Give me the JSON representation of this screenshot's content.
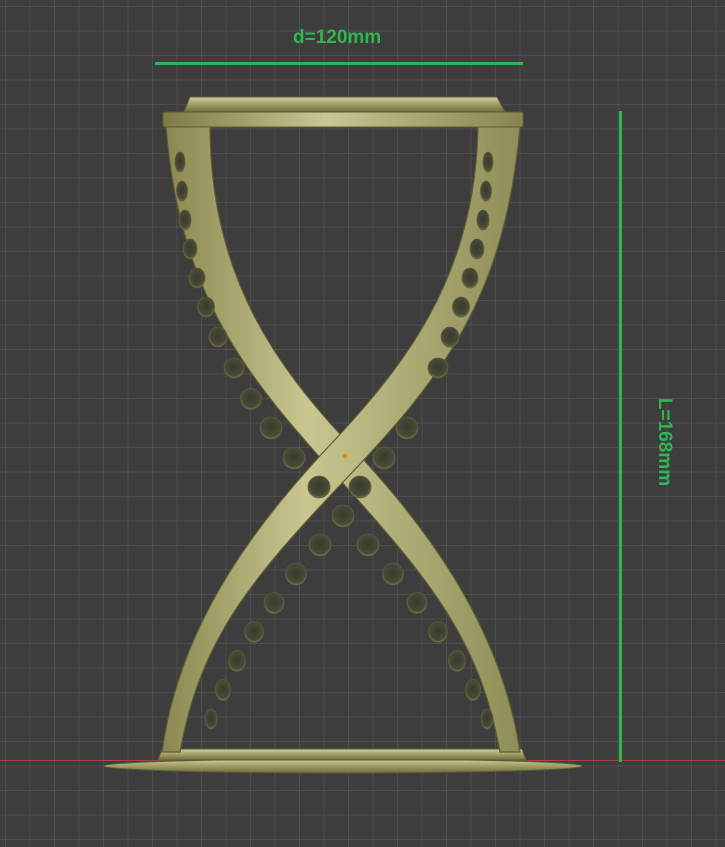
{
  "viewport": {
    "dimensions": {
      "width_label": "d=120mm",
      "height_label": "L=168mm"
    },
    "colors": {
      "background": "#3d3d3d",
      "grid": "#5a5a5a",
      "dimension": "#2fb552",
      "model": "#a7a56a",
      "x_axis": "#a24444",
      "origin": "#e08a1e"
    },
    "model_name": "hourglass-stand"
  }
}
